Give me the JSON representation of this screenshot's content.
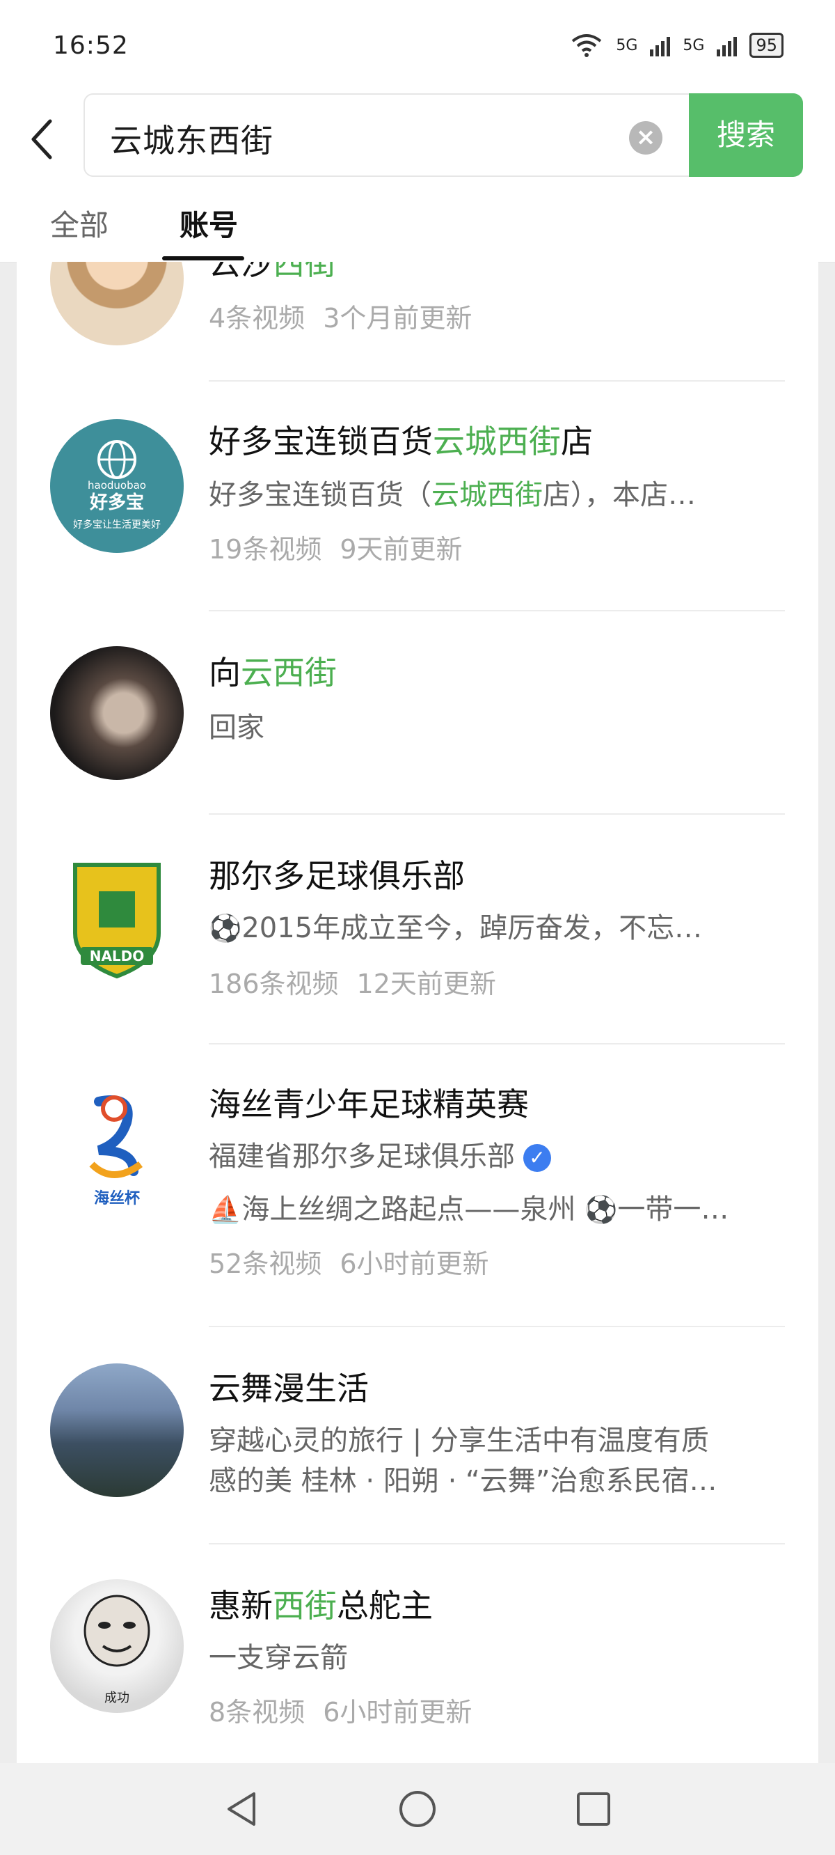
{
  "status_bar": {
    "time": "16:52",
    "network_label_1": "5G",
    "network_label_2": "5G",
    "battery": "95"
  },
  "search": {
    "query": "云城东西街",
    "button_label": "搜索"
  },
  "tabs": [
    {
      "label": "全部"
    },
    {
      "label": "账号"
    }
  ],
  "results": [
    {
      "name_parts": [
        "云沙",
        "西街"
      ],
      "meta": [
        "4条视频",
        "3个月前更新"
      ]
    },
    {
      "name_parts": [
        "好多宝连锁百货",
        "云城西街",
        "店"
      ],
      "desc_parts": [
        "好多宝连锁百货（",
        "云城西街",
        "店），本店…"
      ],
      "avatar_text_top": "haoduobao",
      "avatar_text_main": "好多宝",
      "avatar_text_bottom": "好多宝让生活更美好",
      "meta": [
        "19条视频",
        "9天前更新"
      ]
    },
    {
      "name_parts": [
        "向",
        "云西街"
      ],
      "desc": "回家"
    },
    {
      "name": "那尔多足球俱乐部",
      "desc_icon": "⚽",
      "desc": "2015年成立至今，踔厉奋发，不忘…",
      "avatar_text": "NALDO",
      "meta": [
        "186条视频",
        "12天前更新"
      ]
    },
    {
      "name": "海丝青少年足球精英赛",
      "org": "福建省那尔多足球俱乐部",
      "desc_icon": "⛵",
      "desc": "海上丝绸之路起点——泉州",
      "desc_icon_2": "⚽",
      "desc_2": "一带一…",
      "avatar_text": "海丝杯",
      "meta": [
        "52条视频",
        "6小时前更新"
      ]
    },
    {
      "name": "云舞漫生活",
      "desc_line1": "穿越心灵的旅行 | 分享生活中有温度有质",
      "desc_line2": "感的美 桂林 · 阳朔 · “云舞”治愈系民宿…"
    },
    {
      "name_parts": [
        "惠新",
        "西街",
        "总舵主"
      ],
      "desc": "一支穿云箭",
      "avatar_text": "成功",
      "meta": [
        "8条视频",
        "6小时前更新"
      ]
    }
  ],
  "colors": {
    "accent": "#57be6a",
    "highlight": "#4caf50",
    "background": "#ededed"
  },
  "icons": [
    "back-arrow-icon",
    "clear-icon",
    "wifi-icon",
    "signal-icon",
    "battery-icon",
    "verified-icon",
    "nav-back-icon",
    "nav-home-icon",
    "nav-recent-icon"
  ]
}
